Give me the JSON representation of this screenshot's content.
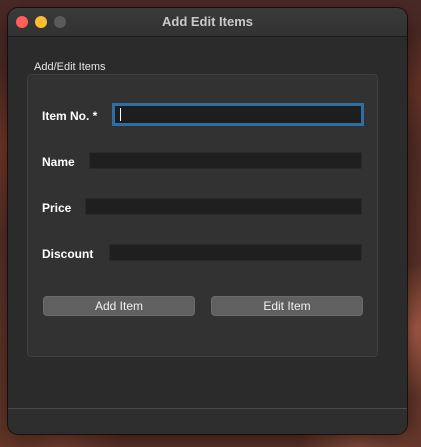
{
  "window": {
    "title": "Add Edit Items"
  },
  "group": {
    "label": "Add/Edit Items"
  },
  "fields": {
    "item_no": {
      "label": "Item No. *",
      "value": ""
    },
    "name": {
      "label": "Name",
      "value": ""
    },
    "price": {
      "label": "Price",
      "value": ""
    },
    "discount": {
      "label": "Discount",
      "value": ""
    }
  },
  "buttons": {
    "add_label": "Add Item",
    "edit_label": "Edit Item"
  },
  "colors": {
    "accent_focus": "#2d6ea5",
    "close": "#ff5f57",
    "minimize": "#febc2e",
    "zoom_inactive": "#5a5a5a"
  }
}
